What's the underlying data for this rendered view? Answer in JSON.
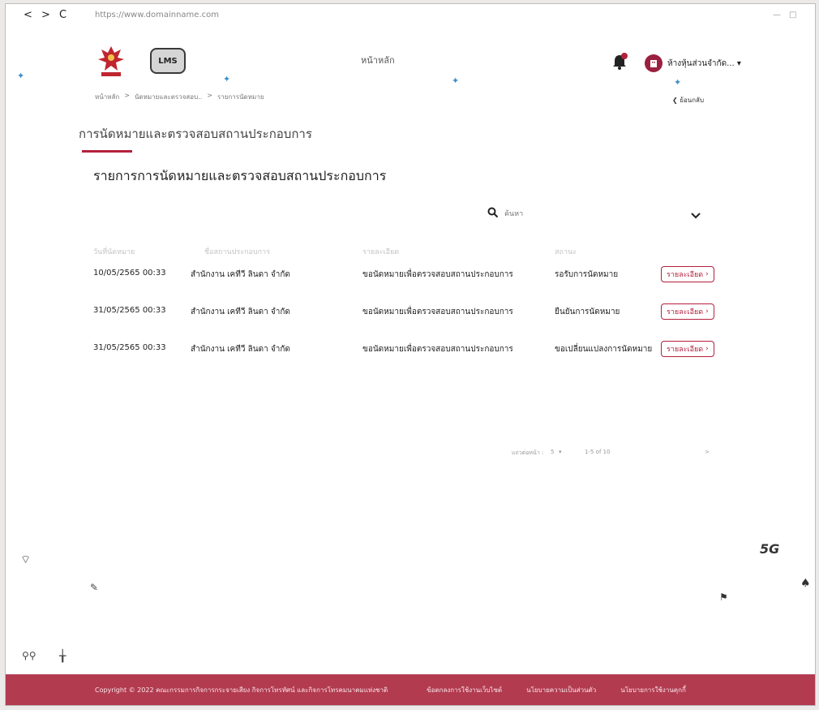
{
  "browser": {
    "back": "<",
    "forward": ">",
    "reload": "C",
    "url": "https://www.domainname.com"
  },
  "header": {
    "lms_logo_text": "LMS",
    "home_link": "หน้าหลัก",
    "user_name": "ห้างหุ้นส่วนจำกัด...",
    "back_label": "ย้อนกลับ",
    "breadcrumb": [
      "หน้าหลัก",
      "นัดหมายและตรวจสอบ..",
      "รายการนัดหมาย"
    ],
    "breadcrumb_sep": ">"
  },
  "page": {
    "title": "การนัดหมายและตรวจสอบสถานประกอบการ",
    "section_title": "รายการการนัดหมายและตรวจสอบสถานประกอบการ"
  },
  "colors": {
    "accent": "#b3213c",
    "footer": "#b23b50"
  },
  "search": {
    "placeholder": "ค้นหา"
  },
  "table": {
    "headers": [
      "วันที่นัดหมาย",
      "ชื่อสถานประกอบการ",
      "รายละเอียด",
      "สถานะ"
    ],
    "detail_label": "รายละเอียด",
    "rows": [
      {
        "date": "10/05/2565  00:33",
        "company": "สำนักงาน เคทีวี ลินดา จำกัด",
        "detail": "ขอนัดหมายเพื่อตรวจสอบสถานประกอบการ",
        "status": "รอรับการนัดหมาย"
      },
      {
        "date": "31/05/2565  00:33",
        "company": "สำนักงาน เคทีวี ลินดา จำกัด",
        "detail": "ขอนัดหมายเพื่อตรวจสอบสถานประกอบการ",
        "status": "ยืนยันการนัดหมาย"
      },
      {
        "date": "31/05/2565  00:33",
        "company": "สำนักงาน เคทีวี ลินดา จำกัด",
        "detail": "ขอนัดหมายเพื่อตรวจสอบสถานประกอบการ",
        "status": "ขอเปลี่ยนแปลงการนัดหมาย"
      }
    ]
  },
  "pagination": {
    "rows_per_page_label": "แถวต่อหน้า :",
    "rows_per_page": "5",
    "range": "1-5 of 10",
    "next": ">"
  },
  "decor": {
    "fiveg": "5G"
  },
  "footer": {
    "copyright": "Copyright © 2022 คณะกรรมการกิจการกระจายเสียง กิจการโทรทัศน์ และกิจการโทรคมนาคมแห่งชาติ",
    "links": [
      "ข้อตกลงการใช้งานเว็บไซต์",
      "นโยบายความเป็นส่วนตัว",
      "นโยบายการใช้งานคุกกี้"
    ]
  }
}
